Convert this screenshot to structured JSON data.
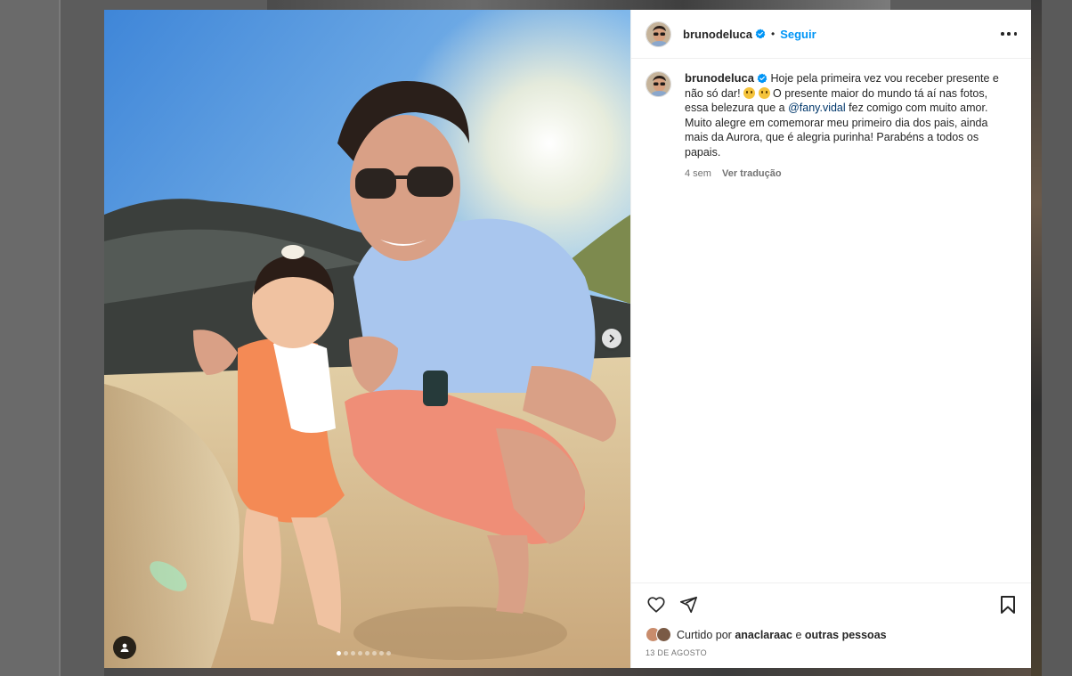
{
  "post": {
    "username": "brunodeluca",
    "follow_label": "Seguir",
    "separator": "•",
    "caption_parts": {
      "part1": "Hoje pela primeira vez vou receber presente e não só dar!",
      "part2": "O presente maior do mundo tá aí nas fotos, essa belezura que a",
      "mention": "@fany.vidal",
      "part3": "fez comigo com muito amor. Muito alegre em comemorar meu primeiro dia dos pais, ainda mais da Aurora, que é alegria purinha! Parabéns a todos os papais."
    },
    "time_ago": "4 sem",
    "see_translation": "Ver tradução",
    "liked_by_prefix": "Curtido por",
    "liked_by_user": "anaclaraac",
    "liked_by_connector": "e",
    "liked_by_others": "outras pessoas",
    "date": "13 DE AGOSTO"
  },
  "carousel": {
    "total_slides": 8,
    "active_slide": 1
  },
  "icons": {
    "more": "more-options-icon",
    "verified": "verified-badge-icon",
    "next": "chevron-right-icon",
    "user_tag": "user-tag-icon",
    "like": "heart-icon",
    "share": "paper-plane-icon",
    "save": "bookmark-icon"
  },
  "colors": {
    "accent": "#0095f6",
    "verified": "#0095f6",
    "mention": "#00376b",
    "muted": "#737373"
  }
}
